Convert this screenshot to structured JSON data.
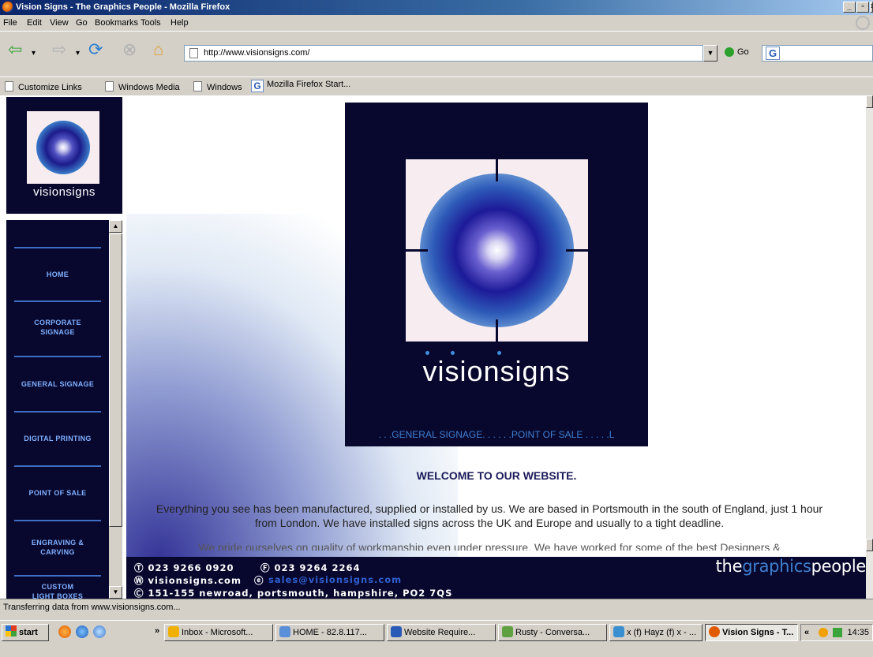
{
  "window": {
    "title": "Vision Signs - The Graphics People - Mozilla Firefox",
    "min": "_",
    "max": "▫",
    "close": "×"
  },
  "menu": [
    "File",
    "Edit",
    "View",
    "Go",
    "Bookmarks",
    "Tools",
    "Help"
  ],
  "nav": {
    "url": "http://www.visionsigns.com/",
    "go_label": "Go",
    "search_icon": "G"
  },
  "bookmarks": [
    {
      "label": "Customize Links",
      "icon": "page-icon"
    },
    {
      "label": "Windows Media",
      "icon": "page-icon"
    },
    {
      "label": "Windows",
      "icon": "page-icon"
    },
    {
      "label": "Mozilla Firefox Start...",
      "icon": "google-icon"
    }
  ],
  "site": {
    "logo_small_text": "visionsigns",
    "sidenav": [
      "HOME",
      "CORPORATE SIGNAGE",
      "GENERAL SIGNAGE",
      "DIGITAL PRINTING",
      "POINT OF SALE",
      "ENGRAVING & CARVING",
      "CUSTOM LIGHT BOXES"
    ],
    "hero_wordmark": "visionsigns",
    "hero_strap": ". . .GENERAL SIGNAGE. . . . . .POINT OF SALE . . . . .L",
    "welcome": "WELCOME TO OUR WEBSITE.",
    "paragraph": "Everything you see has been manufactured, supplied or installed by us. We are based in Portsmouth in the south of England, just 1 hour from London. We have installed signs across the UK and Europe and usually to a tight deadline.",
    "paragraph2": "We pride ourselves on quality of workmanship even under pressure. We have worked for some of the best Designers &",
    "footer": {
      "phone": "Ⓣ 023 9266 0920",
      "fax": "Ⓕ 023 9264 2264",
      "web": "Ⓦ visionsigns.com",
      "email_prefix": "ⓔ",
      "email": "sales@visionsigns.com",
      "address": "Ⓒ 151-155 newroad, portsmouth, hampshire, PO2 7QS",
      "brand_the": "the",
      "brand_graphics": "graphics",
      "brand_people": "people"
    }
  },
  "status": "Transferring data from www.visionsigns.com...",
  "taskbar": {
    "start": "start",
    "more": "»",
    "tasks": [
      {
        "label": "Inbox - Microsoft...",
        "active": false,
        "color": "#f0b000"
      },
      {
        "label": "HOME - 82.8.117...",
        "active": false,
        "color": "#5b8fd8"
      },
      {
        "label": "Website Require...",
        "active": false,
        "color": "#2a5ab8"
      },
      {
        "label": "Rusty - Conversa...",
        "active": false,
        "color": "#5fa040"
      },
      {
        "label": "x (f) Hayz (f) x - ...",
        "active": false,
        "color": "#3a8fd0"
      },
      {
        "label": "Vision Signs - T...",
        "active": true,
        "color": "#e05a00"
      }
    ],
    "tray_arrow": "«",
    "clock": "14:35"
  }
}
